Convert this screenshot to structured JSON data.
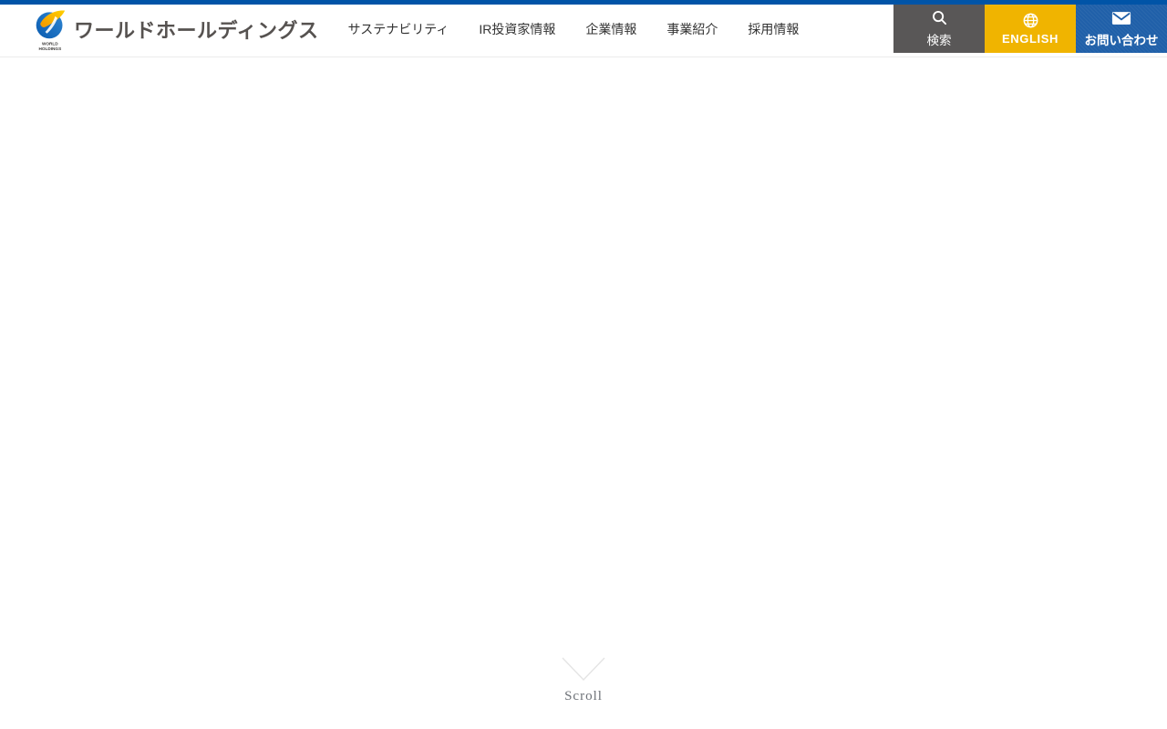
{
  "header": {
    "brand": {
      "logo_caption": "WORLD\nHOLDINGS",
      "wordmark": "ワールドホールディングス"
    },
    "nav": [
      {
        "label": "サステナビリティ"
      },
      {
        "label": "IR投資家情報"
      },
      {
        "label": "企業情報"
      },
      {
        "label": "事業紹介"
      },
      {
        "label": "採用情報"
      }
    ],
    "actions": {
      "search": {
        "label": "検索"
      },
      "english": {
        "label": "ENGLISH"
      },
      "contact": {
        "label": "お問い合わせ"
      }
    }
  },
  "main": {
    "scroll_label": "Scroll"
  },
  "colors": {
    "top_bar": "#0054a7",
    "search_button_bg": "#595757",
    "english_button_bg": "#f0b400",
    "contact_button_bg": "#2060a9",
    "nav_text": "#333333",
    "wordmark_text": "#565250",
    "scroll_text": "#6d7177"
  }
}
